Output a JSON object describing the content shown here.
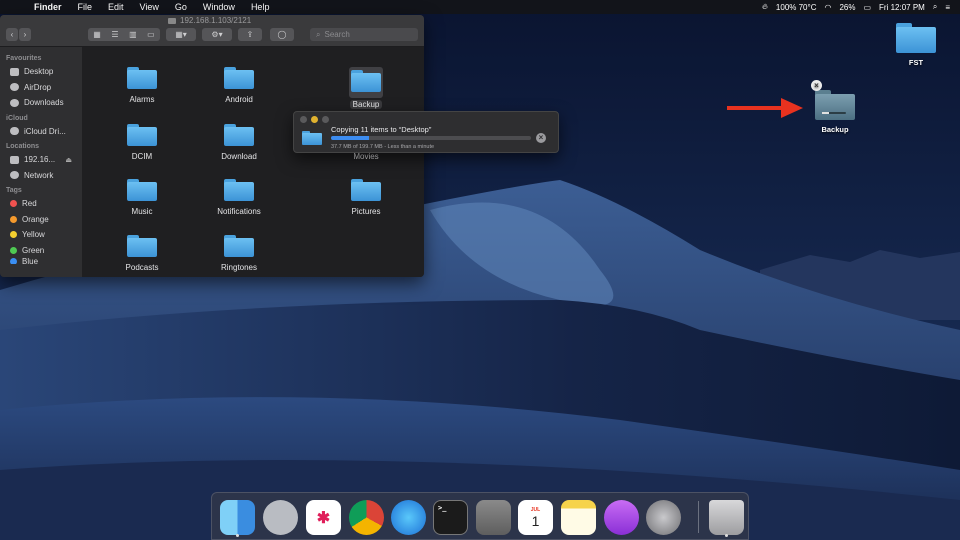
{
  "menubar": {
    "app_name": "Finder",
    "items": [
      "File",
      "Edit",
      "View",
      "Go",
      "Window",
      "Help"
    ],
    "status": {
      "temperature": "100% 70°C",
      "battery": "26%",
      "clock": "Fri 12:07 PM"
    }
  },
  "finder": {
    "path_title": "192.168.1.103/2121",
    "search_placeholder": "Search",
    "sidebar": {
      "favourites_header": "Favourites",
      "favourites": [
        "Desktop",
        "AirDrop",
        "Downloads"
      ],
      "icloud_header": "iCloud",
      "icloud": [
        "iCloud Dri..."
      ],
      "locations_header": "Locations",
      "locations": [
        "192.16...",
        "Network"
      ],
      "tags_header": "Tags",
      "tags": [
        {
          "label": "Red",
          "color": "#f0524f"
        },
        {
          "label": "Orange",
          "color": "#f59a2d"
        },
        {
          "label": "Yellow",
          "color": "#f4cf2f"
        },
        {
          "label": "Green",
          "color": "#4fca53"
        },
        {
          "label": "Blue",
          "color": "#3a8ef2"
        }
      ]
    },
    "files": [
      "Alarms",
      "Android",
      "Backup",
      "DCIM",
      "Download",
      "Movies",
      "Music",
      "Notifications",
      "Pictures",
      "Podcasts",
      "Ringtones"
    ]
  },
  "copy_dialog": {
    "title": "Copying 11 items to “Desktop”",
    "status": "37.7 MB of 199.7 MB - Less than a minute",
    "progress": 0.19
  },
  "desktop": {
    "icons": [
      "FST",
      "Backup"
    ],
    "backup_progress": 0.3
  },
  "dock": {
    "apps": [
      "finder",
      "launchpad",
      "slack",
      "chrome",
      "safari",
      "terminal",
      "calculator",
      "calendar",
      "notes",
      "podcasts",
      "system-preferences",
      "trash"
    ],
    "calendar_day": "1",
    "calendar_month": "JUL"
  },
  "colors": {
    "accent": "#3c8cf0",
    "folder_blue": "#4aa2de",
    "arrow_red": "#e8321f"
  }
}
